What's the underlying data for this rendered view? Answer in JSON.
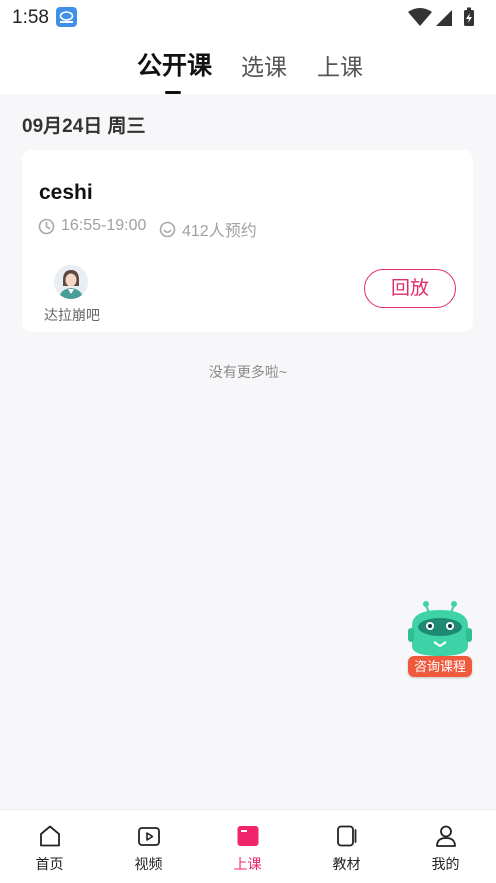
{
  "status_bar": {
    "time": "1:58"
  },
  "top_tabs": [
    {
      "label": "公开课",
      "active": true
    },
    {
      "label": "选课",
      "active": false
    },
    {
      "label": "上课",
      "active": false
    }
  ],
  "date_header": "09月24日 周三",
  "course": {
    "title": "ceshi",
    "time_range": "16:55-19:00",
    "bookings": "412人预约",
    "teacher_name": "达拉崩吧",
    "replay_label": "回放"
  },
  "no_more_text": "没有更多啦~",
  "consult_label": "咨询课程",
  "bottom_nav": [
    {
      "label": "首页",
      "icon": "home-icon",
      "active": false
    },
    {
      "label": "视频",
      "icon": "video-icon",
      "active": false
    },
    {
      "label": "上课",
      "icon": "class-icon",
      "active": true
    },
    {
      "label": "教材",
      "icon": "book-icon",
      "active": false
    },
    {
      "label": "我的",
      "icon": "profile-icon",
      "active": false
    }
  ],
  "colors": {
    "accent": "#f0246b",
    "replay": "#e42c67",
    "consult_label_bg": "#f05a3c",
    "mascot": "#3ed3a6"
  }
}
